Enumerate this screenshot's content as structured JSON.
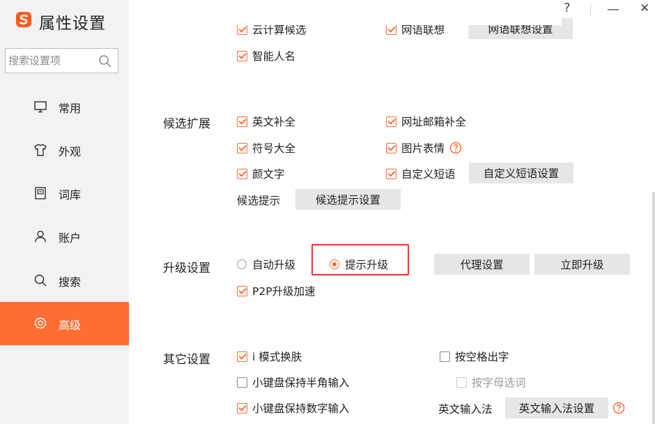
{
  "app": {
    "title": "属性设置",
    "logo_icon": "sogou-logo-icon"
  },
  "search": {
    "placeholder": "搜索设置项"
  },
  "window": {
    "help_glyph": "?",
    "minimize_glyph": "—",
    "close_glyph": "✕"
  },
  "sidebar": {
    "items": [
      {
        "label": "常用",
        "icon": "monitor-icon"
      },
      {
        "label": "外观",
        "icon": "shirt-icon"
      },
      {
        "label": "词库",
        "icon": "dictionary-icon"
      },
      {
        "label": "账户",
        "icon": "user-icon"
      },
      {
        "label": "搜索",
        "icon": "search-icon"
      },
      {
        "label": "高级",
        "icon": "gear-icon",
        "active": true
      }
    ]
  },
  "top_partial": {
    "cloud": "云计算候选",
    "phrase": "网语联想",
    "phrase_btn": "网语联想设置",
    "smart_name": "智能人名"
  },
  "candidate_ext": {
    "label": "候选扩展",
    "english_complete": "英文补全",
    "url_email": "网址邮箱补全",
    "symbols": "符号大全",
    "picture_emoji": "图片表情",
    "kaomoji": "颜文字",
    "custom_phrase": "自定义短语",
    "custom_phrase_btn": "自定义短语设置",
    "hint_label": "候选提示",
    "hint_btn": "候选提示设置"
  },
  "upgrade": {
    "label": "升级设置",
    "auto": "自动升级",
    "prompt": "提示升级",
    "selected": "提示升级",
    "proxy_btn": "代理设置",
    "now_btn": "立即升级",
    "p2p": "P2P升级加速"
  },
  "other": {
    "label": "其它设置",
    "i_mode": "i 模式换肤",
    "space_output": "按空格出字",
    "keypad_halfwidth": "小键盘保持半角输入",
    "letter_select": "按字母选词",
    "keypad_digits": "小键盘保持数字输入",
    "english_ime_label": "英文输入法",
    "english_ime_btn": "英文输入法设置"
  },
  "colors": {
    "accent": "#fe6d32",
    "highlight": "#e53935",
    "sidebar_bg": "#f2f2f2",
    "button_bg": "#e6e6e6"
  }
}
